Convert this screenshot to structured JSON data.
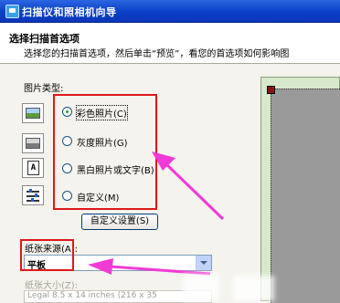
{
  "window": {
    "title": "扫描仪和照相机向导"
  },
  "header": {
    "title": "选择扫描首选项",
    "subtitle": "选择您的扫描首选项，然后单击“预览”，看您的首选项如何影响图"
  },
  "picture_type": {
    "label": "图片类型:",
    "options": [
      {
        "label": "彩色照片(C)",
        "selected": true,
        "icon": "color-photo-icon"
      },
      {
        "label": "灰度照片(G)",
        "selected": false,
        "icon": "grayscale-photo-icon"
      },
      {
        "label": "黑白照片或文字(B)",
        "selected": false,
        "icon": "bw-text-icon"
      },
      {
        "label": "自定义(M)",
        "selected": false,
        "icon": "custom-settings-icon"
      }
    ],
    "custom_button": "自定义设置(S)"
  },
  "paper_source": {
    "label": "纸张来源(A):",
    "value": "平板"
  },
  "paper_size": {
    "label": "纸张大小(Z):",
    "value": "Legal 8.5 x 14 inches (216 x 35"
  },
  "annotation_color": "#e01818",
  "arrow_color": "#f23ad6"
}
